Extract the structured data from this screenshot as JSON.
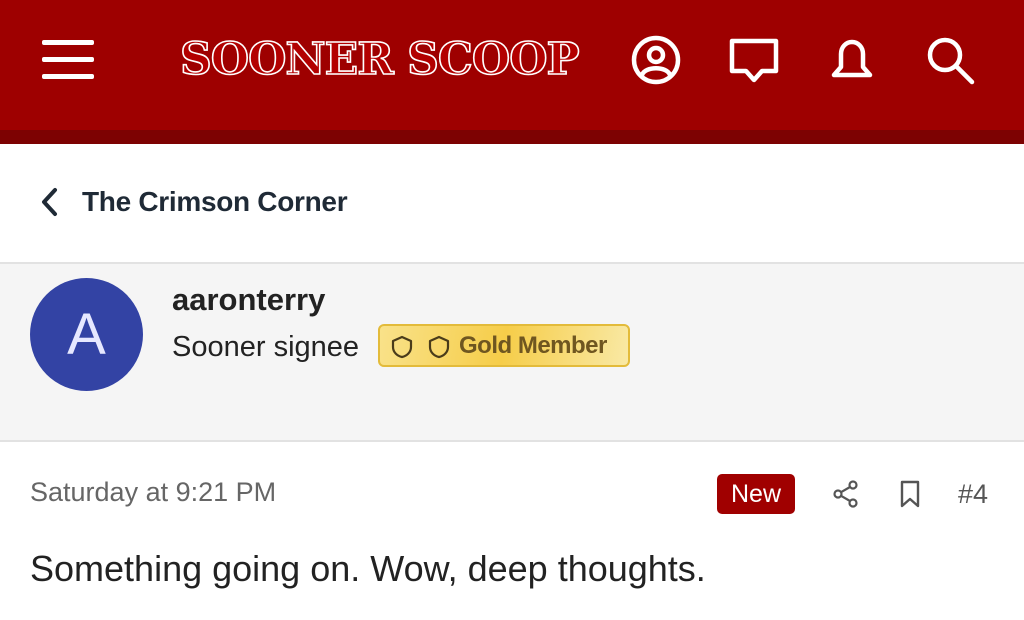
{
  "header": {
    "site_name": "SOONER SCOOP",
    "icons": [
      "menu-icon",
      "account-icon",
      "messages-icon",
      "alerts-icon",
      "search-icon"
    ],
    "colors": {
      "bar": "#9e0000",
      "bar_shadow": "#7d0202"
    }
  },
  "breadcrumb": {
    "title": "The Crimson Corner"
  },
  "author": {
    "avatar_letter": "A",
    "avatar_color": "#3343a4",
    "username": "aaronterry",
    "user_title": "Sooner signee",
    "membership_label": "Gold Member"
  },
  "post": {
    "date": "Saturday at 9:21 PM",
    "new_label": "New",
    "post_number": "#4",
    "body": "Something going on. Wow, deep thoughts."
  }
}
